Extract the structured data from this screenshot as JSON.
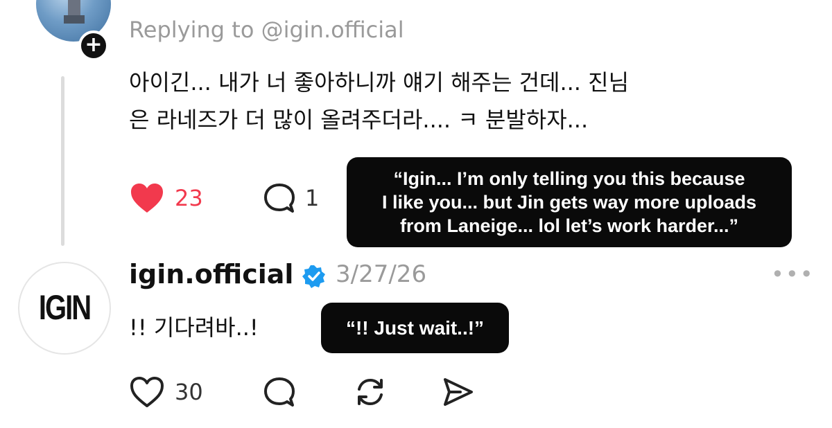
{
  "reply": {
    "replying_to": "Replying to @igin.official",
    "body_lines": [
      "아이긴... 내가 너 좋아하니까 얘기 해주는 건데... 진님",
      "은 라네즈가 더 많이 올려주더라.... ㅋ 분발하자..."
    ],
    "likes": "23",
    "comments": "1",
    "liked": true,
    "like_color": "#f2394d"
  },
  "overlay_top": {
    "lines": [
      "“Igin... I’m only telling you this because",
      "I like you... but Jin gets way more uploads",
      "from Laneige... lol let’s work harder...”"
    ]
  },
  "comment": {
    "avatar_text": "IGIN",
    "username": "igin.official",
    "verified": true,
    "verified_color": "#1d9bf0",
    "date": "3/27/26",
    "more": "•••",
    "body": "!! 기다려바..!",
    "likes": "30"
  },
  "overlay_bottom": {
    "text": "“!! Just wait..!”"
  },
  "icons": {
    "reply_badge": "plus-icon",
    "heart_filled": "heart-filled-icon",
    "heart_outline": "heart-icon",
    "comment": "comment-bubble-icon",
    "repost": "repost-icon",
    "share": "send-icon",
    "verified": "verified-badge-icon"
  }
}
